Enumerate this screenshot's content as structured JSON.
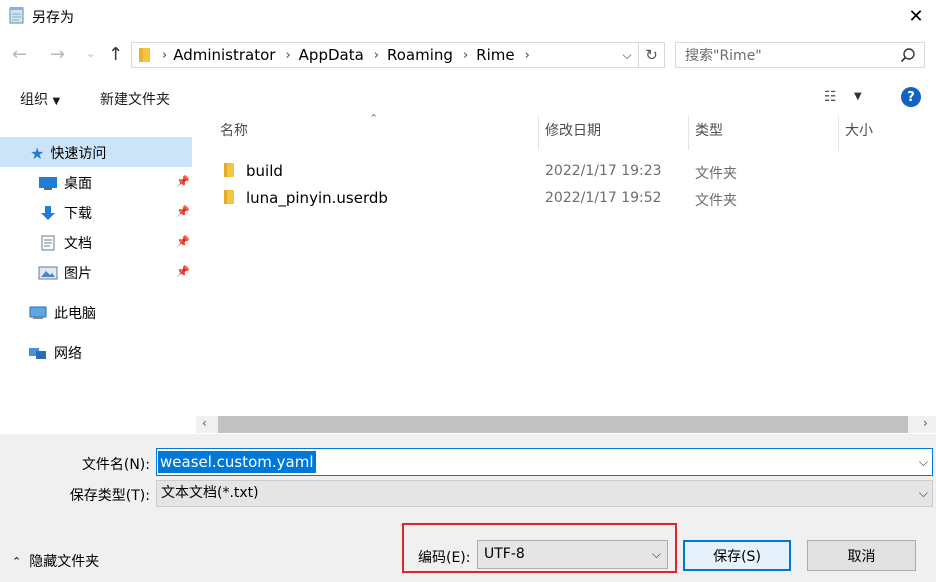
{
  "window": {
    "title": "另存为"
  },
  "address": {
    "crumbs": [
      "Administrator",
      "AppData",
      "Roaming",
      "Rime"
    ]
  },
  "search": {
    "placeholder": "搜索\"Rime\""
  },
  "toolbar": {
    "organize": "组织",
    "new_folder": "新建文件夹",
    "help": "?"
  },
  "sidebar": {
    "quick_access": "快速访问",
    "items": [
      {
        "label": "桌面",
        "icon": "desktop-icon"
      },
      {
        "label": "下载",
        "icon": "download-icon"
      },
      {
        "label": "文档",
        "icon": "document-icon"
      },
      {
        "label": "图片",
        "icon": "picture-icon"
      }
    ],
    "this_pc": "此电脑",
    "network": "网络"
  },
  "columns": {
    "name": "名称",
    "modified": "修改日期",
    "type": "类型",
    "size": "大小"
  },
  "files": [
    {
      "name": "build",
      "modified": "2022/1/17 19:23",
      "type": "文件夹"
    },
    {
      "name": "luna_pinyin.userdb",
      "modified": "2022/1/17 19:52",
      "type": "文件夹"
    }
  ],
  "form": {
    "filename_label": "文件名(N):",
    "filename_value": "weasel.custom.yaml",
    "filetype_label": "保存类型(T):",
    "filetype_value": "文本文档(*.txt)",
    "encoding_label": "编码(E):",
    "encoding_value": "UTF-8"
  },
  "buttons": {
    "hide_folders": "隐藏文件夹",
    "save": "保存(S)",
    "cancel": "取消"
  },
  "colors": {
    "accent": "#0078d7",
    "highlight": "#e0242c",
    "selected_bg": "#cce4f7"
  }
}
